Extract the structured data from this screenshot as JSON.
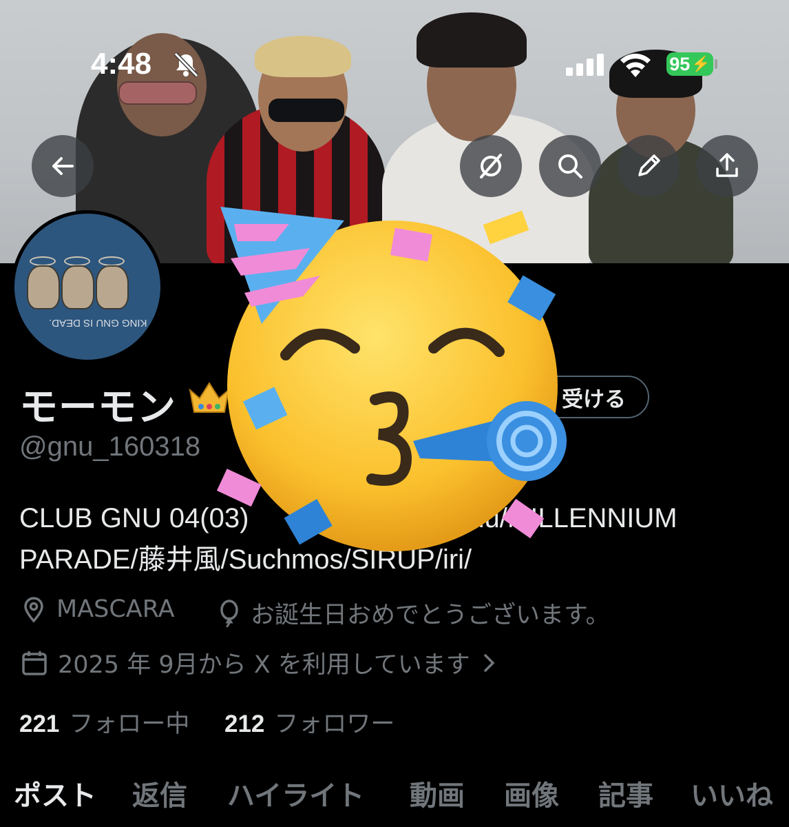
{
  "status_bar": {
    "time": "4:48",
    "battery": "95",
    "icons": [
      "bell-slash-icon",
      "cellular-signal-icon",
      "wifi-icon",
      "battery-charging-icon"
    ]
  },
  "banner": {
    "buttons": [
      "back-arrow-icon",
      "grok-icon",
      "search-icon",
      "edit-pencil-icon",
      "share-icon"
    ]
  },
  "avatar": {
    "text": "KING GNU IS DEAD."
  },
  "profile": {
    "name": "モーモン",
    "name_emoji": "crown-emoji",
    "handle": "@gnu_160318",
    "subscribe_label": "受ける",
    "bio_line1": "CLUB GNU 04(03)",
    "bio_line1_tail": "ngGnu/MILLENNIUM",
    "bio_line2": "PARADE/藤井風/Suchmos/SIRUP/iri/",
    "location": "MASCARA",
    "birthday": "お誕生日おめでとうございます。",
    "joined": "2025 年 9月から X を利用しています"
  },
  "stats": {
    "following_count": "221",
    "following_label": "フォロー中",
    "followers_count": "212",
    "followers_label": "フォロワー"
  },
  "tabs": [
    "ポスト",
    "返信",
    "ハイライト",
    "動画",
    "画像",
    "記事",
    "いいね"
  ],
  "overlay": "partying-face-emoji",
  "colors": {
    "background": "#000000",
    "text": "#e7e9ea",
    "muted": "#71767b",
    "battery": "#34c759",
    "pill_border": "#536471"
  }
}
